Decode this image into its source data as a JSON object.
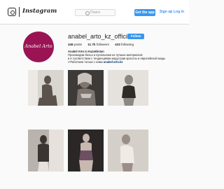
{
  "header": {
    "brand": "Instagram",
    "search_placeholder": "Поиск",
    "get_app": "Get the app",
    "sign_up": "Sign up",
    "separator": "/",
    "log_in": "Log in"
  },
  "profile": {
    "avatar_text": "Anabel Arto",
    "username": "anabel_arto_kz_official",
    "follow_label": "Follow",
    "stats": [
      {
        "count": "446",
        "label": "posts"
      },
      {
        "count": "11.7k",
        "label": "followers"
      },
      {
        "count": "433",
        "label": "following"
      }
    ],
    "bio_name": "Anabel Arto in Kazakhstan",
    "bio_line1": "Производим белье и купальники из лучших материалов",
    "bio_line2": "и в соответствии с тенденциями индустрии красоты и европейской моды",
    "bio_line3": "✔Работаем только с нами",
    "bio_link": "anabel-arto.kz"
  },
  "posts": [
    {
      "palette": [
        "#d9d6d0",
        "#ece9e4",
        "#5a524b"
      ]
    },
    {
      "palette": [
        "#3d3a38",
        "#7d7670",
        "#c9c2bc"
      ]
    },
    {
      "palette": [
        "#e5e1dd",
        "#8c8783",
        "#2d2a28"
      ]
    },
    {
      "palette": [
        "#b9b3ad",
        "#e6e1dc",
        "#3a3532"
      ]
    },
    {
      "palette": [
        "#2a2726",
        "#6e4f62",
        "#c7b8b0"
      ]
    },
    {
      "palette": [
        "#d5cfc9",
        "#efebe6",
        "#9a8f86"
      ]
    }
  ]
}
